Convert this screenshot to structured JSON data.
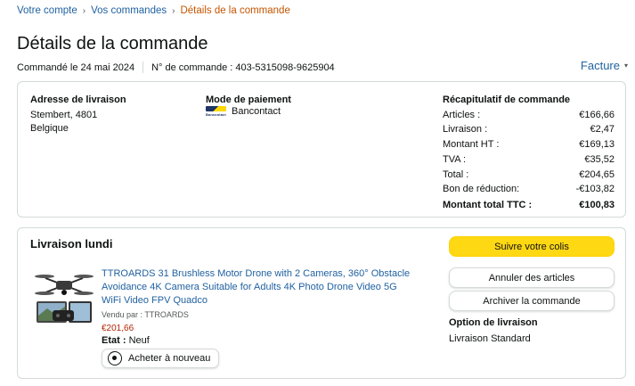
{
  "breadcrumb": {
    "items": [
      "Votre compte",
      "Vos commandes"
    ],
    "current": "Détails de la commande"
  },
  "page": {
    "title": "Détails de la commande",
    "ordered_on": "Commandé le 24 mai 2024",
    "order_number": "N° de commande : 403-5315098-9625904",
    "invoice_label": "Facture"
  },
  "shipping_address": {
    "heading": "Adresse de livraison",
    "line1": "Stembert, 4801",
    "line2": "Belgique"
  },
  "payment": {
    "heading": "Mode de paiement",
    "method": "Bancontact",
    "logo_text": "Bancontact"
  },
  "summary": {
    "heading": "Récapitulatif de commande",
    "rows": [
      {
        "label": "Articles :",
        "value": "€166,66"
      },
      {
        "label": "Livraison :",
        "value": "€2,47"
      },
      {
        "label": "Montant HT :",
        "value": "€169,13"
      },
      {
        "label": "TVA :",
        "value": "€35,52"
      },
      {
        "label": "Total :",
        "value": "€204,65"
      },
      {
        "label": "Bon de réduction:",
        "value": "-€103,82"
      }
    ],
    "grand_total_label": "Montant total TTC :",
    "grand_total_value": "€100,83"
  },
  "shipment": {
    "heading": "Livraison lundi",
    "product_title": "TTROARDS 31 Brushless Motor Drone with 2 Cameras, 360° Obstacle Avoidance 4K Camera Suitable for Adults 4K Photo Drone Video 5G WiFi Video FPV Quadco",
    "seller": "Vendu par : TTROARDS",
    "price": "€201,66",
    "condition_label": "Etat :",
    "condition_value": "Neuf",
    "rebuy_label": "Acheter à nouveau",
    "track_label": "Suivre votre colis",
    "cancel_label": "Annuler des articles",
    "archive_label": "Archiver la commande",
    "option_heading": "Option de livraison",
    "option_value": "Livraison Standard"
  },
  "colors": {
    "link": "#2162a1",
    "breadcrumb_current": "#c45500",
    "price": "#b12704",
    "track_button": "#ffd814"
  },
  "icons": [
    "chevron-down-icon",
    "rebuy-icon",
    "bancontact-logo",
    "drone-product-image"
  ]
}
